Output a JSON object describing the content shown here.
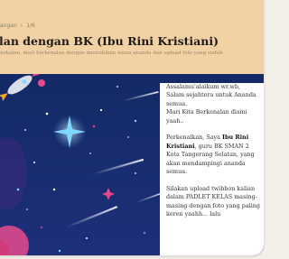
{
  "breadcrumb": {
    "first": "angan",
    "sep": "›",
    "second": "1/6"
  },
  "page": {
    "title": "lan dengan BK (Ibu Rini Kristiani)",
    "subtitle": "nekalan, mari berkenalan dengan memubikan nama ananda dan upload foto yang sudah"
  },
  "post": {
    "greeting": "Assalamu'alaikum wr.wb, Salam sejahtera untuk Ananda semua.",
    "intro_line": "Mari Kita Berkenalan disini yaah..",
    "lead": "Perkenalkan, Saya ",
    "name": "Ibu Rini Kristiani",
    "role": ", guru BK SMAN 2 Kota Tangerang Selatan, yang akan mendampingi ananda semua.",
    "instruction": "Silakan upload twibbon kalian dalam PADLET KELAS masing-masing dengan foto yang paling keren yaahh... lalu"
  },
  "colors": {
    "header_bg": "#f2d2a4",
    "space_bg": "#142860",
    "accent_pink": "#e64a8c",
    "accent_cyan": "#7fd8ff"
  }
}
